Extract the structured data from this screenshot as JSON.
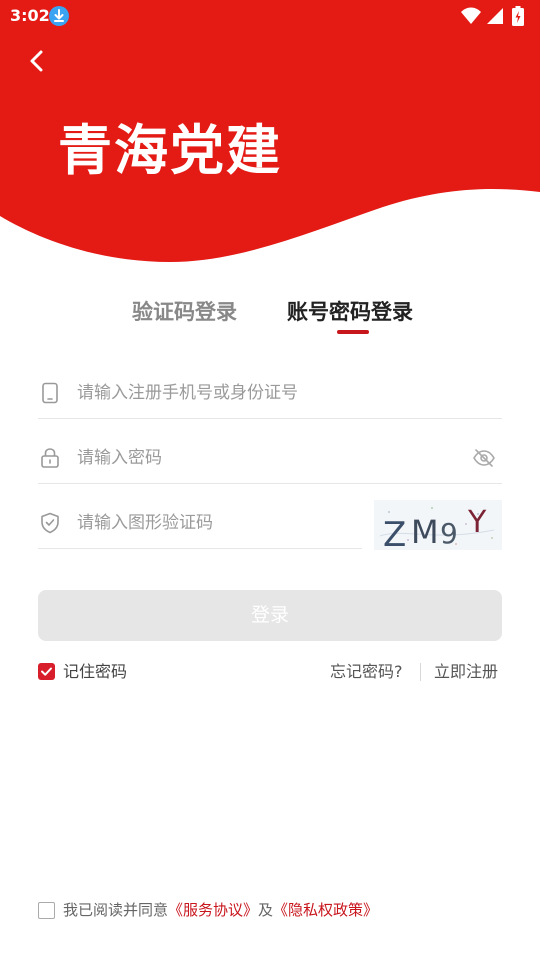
{
  "status_bar": {
    "time": "3:02",
    "icons": [
      "download-icon",
      "wifi-icon",
      "signal-icon",
      "battery-charging-icon"
    ]
  },
  "header": {
    "back_icon": "chevron-left-icon",
    "logo_text": "青海党建",
    "brand_color": "#e41a15"
  },
  "tabs": [
    {
      "label": "验证码登录",
      "active": false
    },
    {
      "label": "账号密码登录",
      "active": true
    }
  ],
  "form": {
    "phone": {
      "placeholder": "请输入注册手机号或身份证号",
      "value": "",
      "icon": "phone-icon"
    },
    "password": {
      "placeholder": "请输入密码",
      "value": "",
      "icon": "lock-icon",
      "toggle_icon": "eye-off-icon"
    },
    "captcha": {
      "placeholder": "请输入图形验证码",
      "value": "",
      "icon": "shield-icon",
      "image_text": "ZM9Y"
    },
    "login_button": "登录"
  },
  "options": {
    "remember_label": "记住密码",
    "remember_checked": true,
    "forgot_link": "忘记密码?",
    "register_link": "立即注册"
  },
  "agreement": {
    "checked": false,
    "prefix": "我已阅读并同意",
    "service_link": "《服务协议》",
    "conjunction": "及",
    "privacy_link": "《隐私权政策》"
  },
  "colors": {
    "accent": "#c8161d",
    "header": "#e41a15",
    "button_disabled": "#e6e6e6"
  }
}
